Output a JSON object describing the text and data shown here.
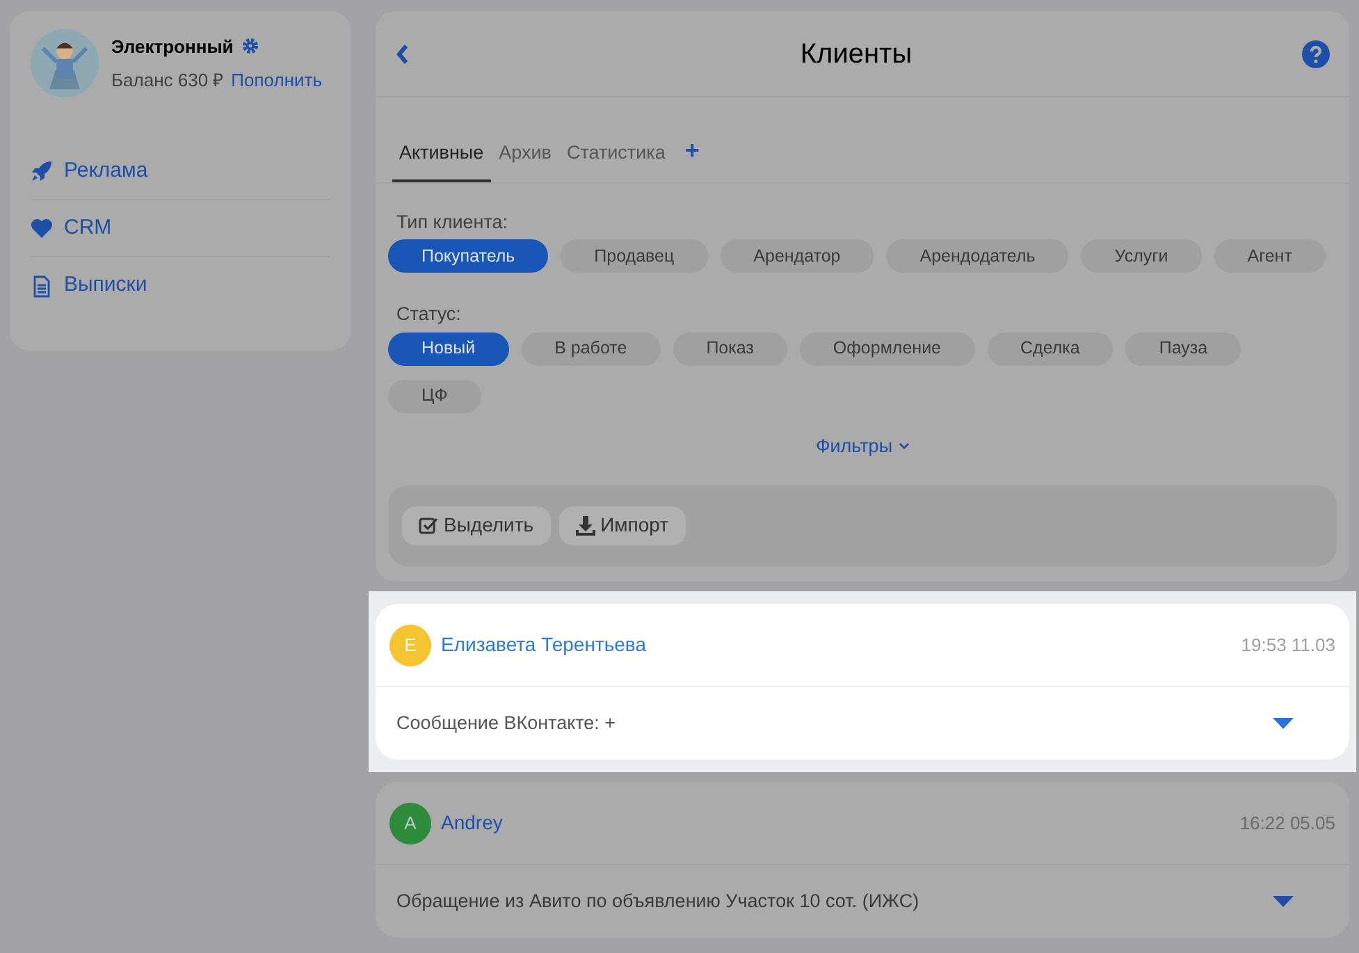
{
  "profile": {
    "name": "Электронный",
    "balance": "Баланс 630 ₽",
    "topup_link": "Пополнить"
  },
  "sidebar": {
    "items": [
      {
        "label": "Реклама",
        "kind": "rocket"
      },
      {
        "label": "CRM",
        "kind": "heart"
      },
      {
        "label": "Выписки",
        "kind": "document"
      }
    ]
  },
  "header": {
    "title": "Клиенты"
  },
  "tabs": [
    {
      "label": "Активные",
      "selected": true
    },
    {
      "label": "Архив",
      "selected": false
    },
    {
      "label": "Статистика",
      "selected": false
    }
  ],
  "add_tab": "+",
  "client_type": {
    "label": "Тип клиента:",
    "options": [
      {
        "label": "Покупатель",
        "selected": true
      },
      {
        "label": "Продавец",
        "selected": false
      },
      {
        "label": "Арендатор",
        "selected": false
      },
      {
        "label": "Арендодатель",
        "selected": false
      },
      {
        "label": "Услуги",
        "selected": false
      },
      {
        "label": "Агент",
        "selected": false
      }
    ]
  },
  "status": {
    "label": "Статус:",
    "options": [
      {
        "label": "Новый",
        "selected": true
      },
      {
        "label": "В работе",
        "selected": false
      },
      {
        "label": "Показ",
        "selected": false
      },
      {
        "label": "Оформление",
        "selected": false
      },
      {
        "label": "Сделка",
        "selected": false
      },
      {
        "label": "Пауза",
        "selected": false
      },
      {
        "label": "ЦФ",
        "selected": false
      }
    ]
  },
  "filters_link": "Фильтры",
  "actions": [
    {
      "label": "Выделить",
      "kind": "check"
    },
    {
      "label": "Импорт",
      "kind": "download"
    }
  ],
  "clients": [
    {
      "initial": "Е",
      "name": "Елизавета Терентьева",
      "time": "19:53 11.03",
      "message": "Сообщение ВКонтакте: +",
      "color": "#f4c531",
      "highlighted": true
    },
    {
      "initial": "A",
      "name": "Andrey",
      "time": "16:22 05.05",
      "message": "Обращение из Авито по объявлению Участок 10 сот. (ИЖС)",
      "color": "#2e8b3c",
      "highlighted": false
    }
  ]
}
